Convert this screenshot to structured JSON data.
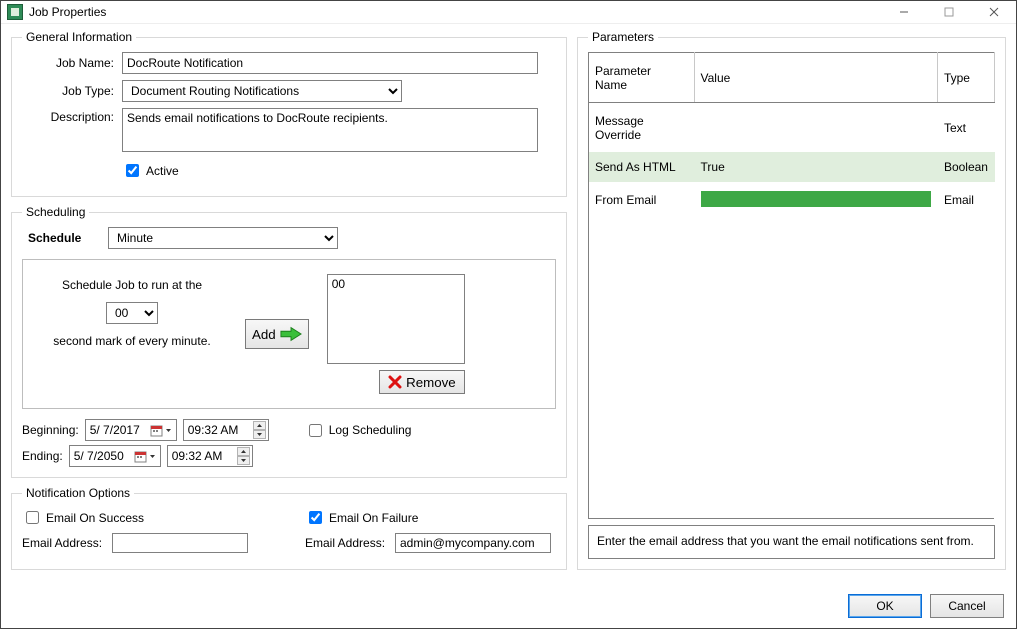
{
  "window": {
    "title": "Job Properties"
  },
  "general": {
    "legend": "General Information",
    "jobName": {
      "label": "Job Name:",
      "value": "DocRoute Notification"
    },
    "jobType": {
      "label": "Job Type:",
      "selected": "Document Routing Notifications"
    },
    "description": {
      "label": "Description:",
      "value": "Sends email notifications to DocRoute recipients."
    },
    "active": {
      "label": "Active",
      "checked": true
    }
  },
  "scheduling": {
    "legend": "Scheduling",
    "scheduleLabel": "Schedule",
    "scheduleSelected": "Minute",
    "runText1": "Schedule Job to run at the",
    "secondSelected": "00",
    "runText2": "second mark of every minute.",
    "addLabel": "Add",
    "listItems": [
      "00"
    ],
    "removeLabel": "Remove",
    "beginning": {
      "label": "Beginning:",
      "date": "5/  7/2017",
      "time": "09:32 AM"
    },
    "ending": {
      "label": "Ending:",
      "date": "5/  7/2050",
      "time": "09:32 AM"
    },
    "logScheduling": {
      "label": "Log Scheduling",
      "checked": false
    }
  },
  "notification": {
    "legend": "Notification Options",
    "success": {
      "label": "Email On Success",
      "checked": false,
      "addressLabel": "Email Address:",
      "addressValue": ""
    },
    "failure": {
      "label": "Email On Failure",
      "checked": true,
      "addressLabel": "Email Address:",
      "addressValue": "admin@mycompany.com"
    }
  },
  "parameters": {
    "legend": "Parameters",
    "headers": {
      "name": "Parameter\nName",
      "value": "Value",
      "type": "Type"
    },
    "rows": [
      {
        "name": "Message Override",
        "value": "",
        "type": "Text"
      },
      {
        "name": "Send As HTML",
        "value": "True",
        "type": "Boolean"
      },
      {
        "name": "From Email",
        "value": "",
        "type": "Email"
      }
    ],
    "hint": "Enter the email address that you want the email notifications sent from."
  },
  "buttons": {
    "ok": "OK",
    "cancel": "Cancel"
  }
}
